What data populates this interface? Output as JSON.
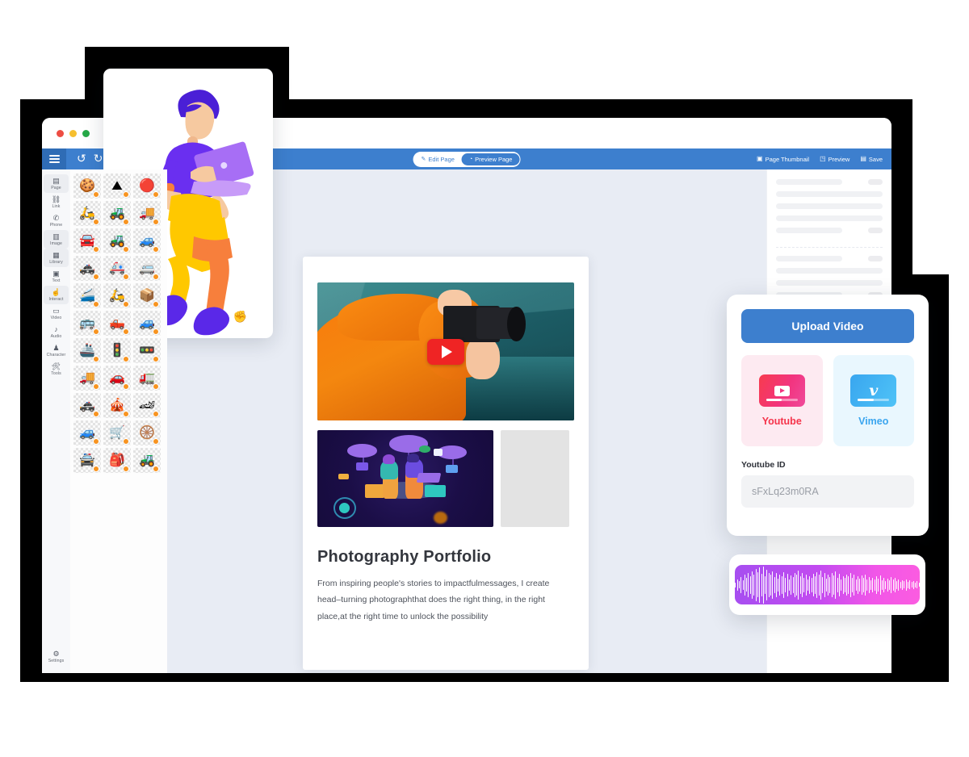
{
  "window": {
    "traffic_lights": [
      "red",
      "yellow",
      "green"
    ]
  },
  "toolbar": {
    "menu_icon": "hamburger-icon",
    "undo_icon": "undo-arrow-icon",
    "redo_icon": "redo-arrow-icon",
    "undo_glyph": "↺",
    "redo_glyph": "↻",
    "modes": [
      {
        "label": "Edit Page",
        "icon": "edit-pencil-icon",
        "glyph": "✎",
        "active": false
      },
      {
        "label": "Preview Page",
        "icon": "preview-eye-icon",
        "glyph": "◔",
        "active": true
      }
    ],
    "actions": [
      {
        "label": "Page Thumbnail",
        "icon": "thumbnail-grid-icon",
        "glyph": "▣"
      },
      {
        "label": "Preview",
        "icon": "preview-screen-icon",
        "glyph": "◳"
      },
      {
        "label": "Save",
        "icon": "save-disk-icon",
        "glyph": "▤"
      }
    ]
  },
  "sidebar": {
    "items": [
      {
        "label": "Page",
        "icon": "page-icon",
        "glyph": "▤"
      },
      {
        "label": "Link",
        "icon": "link-icon",
        "glyph": "⛓"
      },
      {
        "label": "Phone",
        "icon": "phone-icon",
        "glyph": "✆"
      },
      {
        "label": "Image",
        "icon": "image-icon",
        "glyph": "▥"
      },
      {
        "label": "Library",
        "icon": "library-icon",
        "glyph": "▦"
      },
      {
        "label": "Text",
        "icon": "text-icon",
        "glyph": "▣"
      },
      {
        "label": "Interact",
        "icon": "interact-hand-icon",
        "glyph": "☝"
      },
      {
        "label": "Video",
        "icon": "video-icon",
        "glyph": "▭"
      },
      {
        "label": "Audio",
        "icon": "audio-note-icon",
        "glyph": "♪"
      },
      {
        "label": "Character",
        "icon": "character-icon",
        "glyph": "♟"
      },
      {
        "label": "Tools",
        "icon": "tools-icon",
        "glyph": "🛠"
      }
    ],
    "settings": {
      "label": "Settings",
      "icon": "gear-icon",
      "glyph": "⚙"
    }
  },
  "asset_panel": {
    "badge_color": "#f79421",
    "assets": [
      {
        "name": "cookie",
        "glyph": "🍪"
      },
      {
        "name": "sand-dune",
        "glyph": "⛰"
      },
      {
        "name": "red-circle",
        "glyph": "🔴"
      },
      {
        "name": "scooter-blue",
        "glyph": "🛵"
      },
      {
        "name": "tractor-green",
        "glyph": "🚜"
      },
      {
        "name": "truck-box",
        "glyph": "🚚"
      },
      {
        "name": "limousine",
        "glyph": "🚘"
      },
      {
        "name": "tractor-red",
        "glyph": "🚜"
      },
      {
        "name": "suv-gray",
        "glyph": "🚙"
      },
      {
        "name": "police-car",
        "glyph": "🚓"
      },
      {
        "name": "ambulance",
        "glyph": "🚑"
      },
      {
        "name": "van-orange",
        "glyph": "🚐"
      },
      {
        "name": "train-rail",
        "glyph": "🚄"
      },
      {
        "name": "delivery-scooter",
        "glyph": "🛵"
      },
      {
        "name": "parcel-truck",
        "glyph": "📦"
      },
      {
        "name": "school-bus",
        "glyph": "🚌"
      },
      {
        "name": "tow-truck",
        "glyph": "🛻"
      },
      {
        "name": "sedan-blue",
        "glyph": "🚙"
      },
      {
        "name": "boat-cargo",
        "glyph": "🚢"
      },
      {
        "name": "traffic-light-a",
        "glyph": "🚦"
      },
      {
        "name": "traffic-light-b",
        "glyph": "🚥"
      },
      {
        "name": "truck-blue",
        "glyph": "🚚"
      },
      {
        "name": "car-red",
        "glyph": "🚗"
      },
      {
        "name": "truck-orange",
        "glyph": "🚛"
      },
      {
        "name": "police-cruiser",
        "glyph": "🚓"
      },
      {
        "name": "food-cart",
        "glyph": "🎪"
      },
      {
        "name": "race-car",
        "glyph": "🏎"
      },
      {
        "name": "jeep-army",
        "glyph": "🚙"
      },
      {
        "name": "hand-cart",
        "glyph": "🛒"
      },
      {
        "name": "carriage-arch",
        "glyph": "🛞"
      },
      {
        "name": "police-car-front",
        "glyph": "🚔"
      },
      {
        "name": "person-backpack",
        "glyph": "🎒"
      },
      {
        "name": "tank",
        "glyph": "🚜"
      }
    ]
  },
  "canvas": {
    "background_color": "#e8ecf4",
    "content_card": {
      "video_thumbnail": {
        "name": "photographer-video-thumbnail",
        "play_button_icon": "youtube-play-icon",
        "play_color": "#ef2424"
      },
      "illustration_thumbnail": {
        "name": "cloud-tech-illustration"
      },
      "gray_placeholder": {
        "name": "empty-image-placeholder",
        "color": "#e3e3e3"
      },
      "title": "Photography Portfolio",
      "body": "From inspiring people's stories to impactfulmessages, I create head–turning photographthat does the right thing, in the right place,at the right time to unlock the possibility"
    }
  },
  "right_panel": {
    "groups": [
      {
        "rows": [
          {
            "bar_width": "62%",
            "pill": true
          },
          {
            "bar_width": "100%",
            "pill": false
          },
          {
            "bar_width": "100%",
            "pill": false
          },
          {
            "bar_width": "100%",
            "pill": false
          },
          {
            "bar_width": "62%",
            "pill": true
          }
        ]
      },
      {
        "rows": [
          {
            "bar_width": "62%",
            "pill": true
          },
          {
            "bar_width": "100%",
            "pill": false
          },
          {
            "bar_width": "100%",
            "pill": false
          },
          {
            "bar_width": "62%",
            "pill": true
          }
        ]
      },
      {
        "rows": [
          {
            "bar_width": "62%",
            "pill": true
          },
          {
            "bar_width": "100%",
            "pill": false
          }
        ]
      }
    ]
  },
  "illustration_card": {
    "name": "person-with-laptop-illustration",
    "cursor_icon": "grab-hand-cursor",
    "cursor_glyph": "✊",
    "colors": {
      "hair": "#4a1fd6",
      "shirt": "#6a2ff0",
      "pants": "#ffc800",
      "leg": "#f77f3c",
      "shoes": "#6a2ff0",
      "laptop": "#a76ef5",
      "skin": "#f6c9a0"
    }
  },
  "upload_panel": {
    "upload_button": "Upload Video",
    "providers": [
      {
        "label": "Youtube",
        "icon": "youtube-icon",
        "color": "#f5344b",
        "card_color": "#fdeaf1"
      },
      {
        "label": "Vimeo",
        "icon": "vimeo-icon",
        "color": "#3aa5ef",
        "card_color": "#e9f7fe"
      }
    ],
    "field_label": "Youtube ID",
    "field_value": "",
    "field_placeholder": "sFxLq23m0RA"
  },
  "audio_widget": {
    "name": "audio-waveform",
    "gradient_from": "#a64ef0",
    "gradient_to": "#fb5ce0",
    "bars": [
      6,
      14,
      9,
      20,
      12,
      26,
      17,
      30,
      22,
      34,
      26,
      40,
      31,
      44,
      28,
      46,
      22,
      38,
      30,
      26,
      34,
      20,
      30,
      16,
      26,
      22,
      32,
      18,
      28,
      14,
      24,
      20,
      30,
      26,
      36,
      22,
      30,
      18,
      26,
      14,
      22,
      18,
      28,
      22,
      32,
      26,
      36,
      20,
      30,
      16,
      26,
      20,
      30,
      24,
      34,
      18,
      28,
      14,
      22,
      18,
      26,
      22,
      30,
      18,
      26,
      14,
      22,
      16,
      24,
      18,
      26,
      14,
      20,
      12,
      18,
      14,
      22,
      16,
      24,
      12,
      18,
      10,
      16,
      12,
      20,
      14,
      18,
      10,
      14,
      8,
      12,
      9,
      14,
      8,
      11,
      7,
      10,
      6,
      9,
      5
    ]
  }
}
